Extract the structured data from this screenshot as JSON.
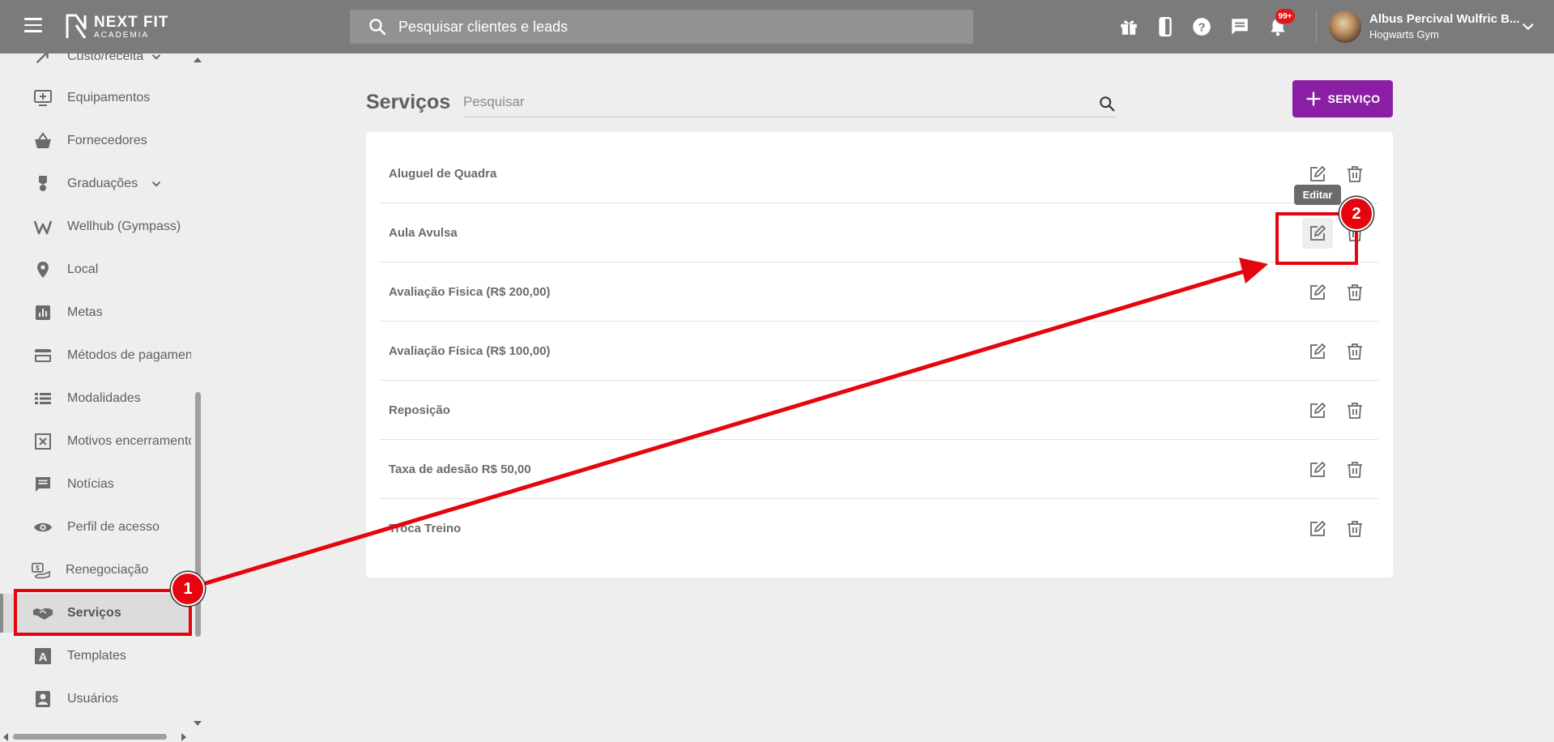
{
  "header": {
    "logo_main": "NEXT FIT",
    "logo_sub": "ACADEMIA",
    "search_placeholder": "Pesquisar clientes e leads",
    "notification_badge": "99+",
    "user_name": "Albus Percival Wulfric B...",
    "user_gym": "Hogwarts Gym",
    "icons": [
      "menu-icon",
      "gift-icon",
      "phone-icon",
      "help-icon",
      "chat-icon",
      "bell-icon",
      "chevron-down-icon"
    ]
  },
  "sidebar": {
    "items": [
      {
        "label": "Custo/receita",
        "icon": "trend-icon",
        "has_chevron": true
      },
      {
        "label": "Equipamentos",
        "icon": "equipment-icon"
      },
      {
        "label": "Fornecedores",
        "icon": "basket-icon"
      },
      {
        "label": "Graduações",
        "icon": "medal-icon",
        "has_chevron": true
      },
      {
        "label": "Wellhub (Gympass)",
        "icon": "wellhub-icon"
      },
      {
        "label": "Local",
        "icon": "location-icon"
      },
      {
        "label": "Metas",
        "icon": "chart-icon"
      },
      {
        "label": "Métodos de pagamento",
        "icon": "card-icon"
      },
      {
        "label": "Modalidades",
        "icon": "list-icon"
      },
      {
        "label": "Motivos encerramento",
        "icon": "close-box-icon"
      },
      {
        "label": "Notícias",
        "icon": "message-icon"
      },
      {
        "label": "Perfil de acesso",
        "icon": "eye-icon"
      },
      {
        "label": "Renegociação",
        "icon": "money-icon"
      },
      {
        "label": "Serviços",
        "icon": "handshake-icon",
        "active": true
      },
      {
        "label": "Templates",
        "icon": "template-icon"
      },
      {
        "label": "Usuários",
        "icon": "user-icon"
      }
    ]
  },
  "main": {
    "title": "Serviços",
    "search_placeholder": "Pesquisar",
    "add_button_label": "SERVIÇO",
    "tooltip": "Editar",
    "services": [
      "Aluguel de Quadra",
      "Aula Avulsa",
      "Avaliação Fisica (R$ 200,00)",
      "Avaliação Física (R$ 100,00)",
      "Reposição",
      "Taxa de adesão R$ 50,00",
      "Troca Treino"
    ]
  },
  "annotations": {
    "step1": "1",
    "step2": "2"
  },
  "colors": {
    "topbar": "#7b7b7b",
    "accent": "#8b1fa3",
    "annotation": "#e5050e",
    "badge": "#e41616"
  }
}
